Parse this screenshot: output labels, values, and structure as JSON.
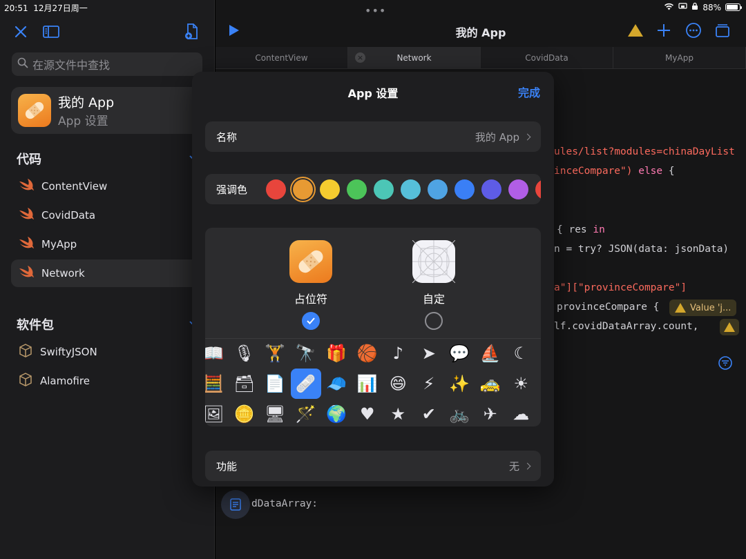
{
  "status": {
    "time": "20:51",
    "date": "12月27日周一",
    "battery": "88%"
  },
  "sidebar": {
    "search_placeholder": "在源文件中查找",
    "app_name": "我的 App",
    "app_settings": "App 设置",
    "code_header": "代码",
    "code_items": [
      "ContentView",
      "CovidData",
      "MyApp",
      "Network"
    ],
    "packages_header": "软件包",
    "packages": [
      "SwiftyJSON",
      "Alamofire"
    ]
  },
  "main": {
    "title": "我的 App",
    "tabs": [
      "ContentView",
      "Network",
      "CovidData",
      "MyApp"
    ],
    "code_lines": {
      "l1": "ules/list?modules=chinaDayList",
      "l2a": "inceCompare\") ",
      "l2b": "else",
      "l2c": " {",
      "l3a": "{ res ",
      "l3b": "in",
      "l4": "n = try? JSON(data: jsonData)",
      "l5": "a\"][\"provinceCompare\"]",
      "l6": "provinceCompare {",
      "l7": "lf.covidDataArray.count,",
      "l8": "dDataArray:"
    },
    "warning_value": "Value 'j..."
  },
  "modal": {
    "title": "App 设置",
    "done": "完成",
    "name_label": "名称",
    "name_value": "我的 App",
    "accent_label": "强调色",
    "accent_colors": [
      "#e8453c",
      "#e79a33",
      "#f5cc2f",
      "#4cc459",
      "#4cc6b6",
      "#56bfd9",
      "#4fa3e3",
      "#3a7ff6",
      "#5e5ce6",
      "#b15ee6",
      "#e8453c"
    ],
    "selected_color_index": 1,
    "placeholder_label": "占位符",
    "custom_label": "自定",
    "feature_label": "功能",
    "feature_value": "无",
    "glyph_rows": [
      [
        "📖",
        "🎙",
        "🏋",
        "🔭",
        "🎁",
        "🏀",
        "♪",
        "➤",
        "💬",
        "⛵",
        "☾"
      ],
      [
        "🧮",
        "🗃",
        "📄",
        "🩹",
        "🧢",
        "📊",
        "😄",
        "⚡",
        "✨",
        "🚕",
        "☀"
      ],
      [
        "🖼",
        "🪙",
        "🖥",
        "🪄",
        "🌍",
        "♥",
        "★",
        "✔",
        "🚲",
        "✈",
        "☁"
      ]
    ],
    "selected_glyph": [
      1,
      3
    ]
  }
}
